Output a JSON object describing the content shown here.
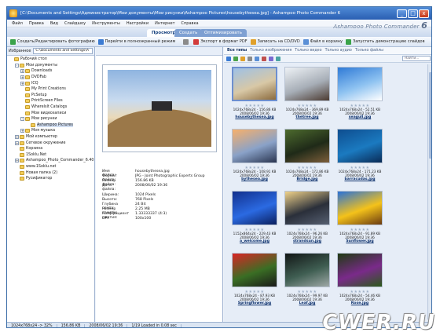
{
  "window": {
    "title": "[C:\\Documents and Settings\\Администратор\\Мои документы\\Мои рисунки\\Ashampoo Pictures\\housebythesea.jpg] - Ashampoo Photo Commander 6",
    "minimize_label": "_",
    "maximize_label": "□",
    "close_label": "x"
  },
  "menu": [
    "Файл",
    "Правка",
    "Вид",
    "Слайдшоу",
    "Инструменты",
    "Настройки",
    "Интернет",
    "Справка"
  ],
  "brand": {
    "prefix": "Ashampoo Photo Commander",
    "version": "6"
  },
  "tabs": [
    "Просмотреть",
    "Создать",
    "Оптимизировать"
  ],
  "toolbar": [
    {
      "label": "Создать/Редактировать фотографию",
      "color": "#3aa34a"
    },
    {
      "label": "Перейти в полноэкранный режим",
      "color": "#3b7bd2"
    },
    {
      "label": "",
      "color": "#8a8a8a"
    },
    {
      "label": "Экспорт в формат PDF",
      "color": "#d23b3b"
    },
    {
      "label": "Записать на CD/DVD",
      "color": "#e0a02a"
    },
    {
      "label": "Файл в корзину",
      "color": "#5a8fd6"
    },
    {
      "label": "Запустить демонстрацию слайдов",
      "color": "#3aa34a"
    }
  ],
  "left_panel": {
    "label": "Избранное",
    "path": "C:\\Documents and Settings\\А"
  },
  "tree": [
    {
      "indent": 0,
      "exp": "",
      "label": "Рабочий стол"
    },
    {
      "indent": 1,
      "exp": "-",
      "label": "Мои документы"
    },
    {
      "indent": 2,
      "exp": "+",
      "label": "Downloads"
    },
    {
      "indent": 2,
      "exp": "+",
      "label": "DVDFab"
    },
    {
      "indent": 2,
      "exp": "+",
      "label": "ICQ"
    },
    {
      "indent": 2,
      "exp": "",
      "label": "My Print Creations"
    },
    {
      "indent": 2,
      "exp": "",
      "label": "PcSetup"
    },
    {
      "indent": 2,
      "exp": "",
      "label": "PrintScreen Files"
    },
    {
      "indent": 2,
      "exp": "",
      "label": "WhereIsIt Catalogs"
    },
    {
      "indent": 2,
      "exp": "",
      "label": "Мои видеозаписи"
    },
    {
      "indent": 2,
      "exp": "-",
      "label": "Мои рисунки"
    },
    {
      "indent": 3,
      "exp": "",
      "label": "Ashampoo Pictures",
      "selected": true
    },
    {
      "indent": 2,
      "exp": "+",
      "label": "Моя музыка"
    },
    {
      "indent": 1,
      "exp": "+",
      "label": "Мой компьютер"
    },
    {
      "indent": 1,
      "exp": "+",
      "label": "Сетевое окружение"
    },
    {
      "indent": 1,
      "exp": "",
      "label": "Корзина"
    },
    {
      "indent": 1,
      "exp": "",
      "label": "1Soklu.Net"
    },
    {
      "indent": 1,
      "exp": "+",
      "label": "Ashampoo_Photo_Commander_6.40"
    },
    {
      "indent": 1,
      "exp": "",
      "label": "www.1Soklu.net"
    },
    {
      "indent": 1,
      "exp": "",
      "label": "Новая папка (2)"
    },
    {
      "indent": 1,
      "exp": "",
      "label": "Русификатор"
    }
  ],
  "file_info": [
    {
      "k": "Имя файла:",
      "v": "housebythesea.jpg"
    },
    {
      "k": "Формат файла:",
      "v": "JPG - Joint Photographic Experts Group"
    },
    {
      "k": "Размер файла:",
      "v": "156.86 KB"
    },
    {
      "k": "Дата файла:",
      "v": "2008/06/02 19:36"
    },
    {
      "k": "",
      "v": ""
    },
    {
      "k": "Ширина:",
      "v": "1024 Pixels"
    },
    {
      "k": "Высота:",
      "v": "768 Pixels"
    },
    {
      "k": "Глубина цвета:",
      "v": "24 Bit"
    },
    {
      "k": "Размер памяти:",
      "v": "2.25 MB"
    },
    {
      "k": "Коэффициент сжатия:",
      "v": "1.33333337 (4:3)"
    },
    {
      "k": "DPI:",
      "v": "100x100"
    }
  ],
  "filters": [
    "Все типы",
    "Только изображения",
    "Только видео",
    "Только аудио",
    "Только файлы"
  ],
  "search": {
    "placeholder": "Найти..."
  },
  "thumbnails": [
    {
      "name": "housebythesea.jpg",
      "meta": "1024x768x24 - 156.86 KB\n2008/06/02 19:36",
      "colors": [
        "#9ec1e6",
        "#d8c8a6",
        "#8b6b3e"
      ],
      "selected": true
    },
    {
      "name": "thetree.jpg",
      "meta": "1024x768x24 - 369.89 KB\n2008/06/02 19:36",
      "colors": [
        "#eef2f6",
        "#a7aeb7",
        "#4b3a30"
      ]
    },
    {
      "name": "seagull.jpg",
      "meta": "1024x768x24 - 52.51 KB\n2008/06/02 19:36",
      "colors": [
        "#2f7ad6",
        "#8fc3f1",
        "#ffffff"
      ]
    },
    {
      "name": "bythesea.jpg",
      "meta": "1024x768x24 - 108.91 KB\n2008/06/02 19:36",
      "colors": [
        "#f7b06b",
        "#8aa2c8",
        "#2a3550"
      ]
    },
    {
      "name": "Bridge.jpg",
      "meta": "1024x768x24 - 172.86 KB\n2008/06/02 19:36",
      "colors": [
        "#4d6b2e",
        "#1f2a18",
        "#7d5e3a"
      ]
    },
    {
      "name": "barracudas.jpg",
      "meta": "1024x768x24 - 171.23 KB\n2008/06/02 19:36",
      "colors": [
        "#0e4d8f",
        "#1b7ac0",
        "#0a2b56"
      ]
    },
    {
      "name": "a_welcome.jpg",
      "meta": "1152x864x24 - 229.43 KB\n2008/06/02 19:36",
      "colors": [
        "#12308d",
        "#2b6ae2",
        "#0a1f5e"
      ]
    },
    {
      "name": "strandsun.jpg",
      "meta": "1024x768x24 - 96.26 KB\n2008/06/02 19:36",
      "colors": [
        "#f0d28a",
        "#2a2f3a",
        "#566072"
      ]
    },
    {
      "name": "Sunflower.jpg",
      "meta": "1024x768x24 - 91.89 KB\n2008/06/02 19:36",
      "colors": [
        "#2a72d8",
        "#f4c21a",
        "#6a3b12"
      ]
    },
    {
      "name": "Springflower.jpg",
      "meta": "1024x768x24 - 87.93 KB\n2008/06/02 19:36",
      "colors": [
        "#d92626",
        "#3a6e24",
        "#1a1a1a"
      ]
    },
    {
      "name": "Leaf.jpg",
      "meta": "1024x768x24 - 99.97 KB\n2008/06/02 19:36",
      "colors": [
        "#121616",
        "#3f5e52",
        "#9ea8a6"
      ]
    },
    {
      "name": "Rose.jpg",
      "meta": "1024x768x24 - 54.46 KB\n2008/06/02 19:36",
      "colors": [
        "#1f3b12",
        "#7a2a8a",
        "#2b5a1a"
      ]
    }
  ],
  "stars": "★★★★★",
  "status": [
    "1024x768x24 -> 32%",
    "156.86 KB",
    "2008/06/02 19:36",
    "1/19  Loaded in 0.08 sec"
  ],
  "watermark": "CWER.RU",
  "icons": {
    "app": "camera-icon",
    "folder": "folder-icon"
  }
}
